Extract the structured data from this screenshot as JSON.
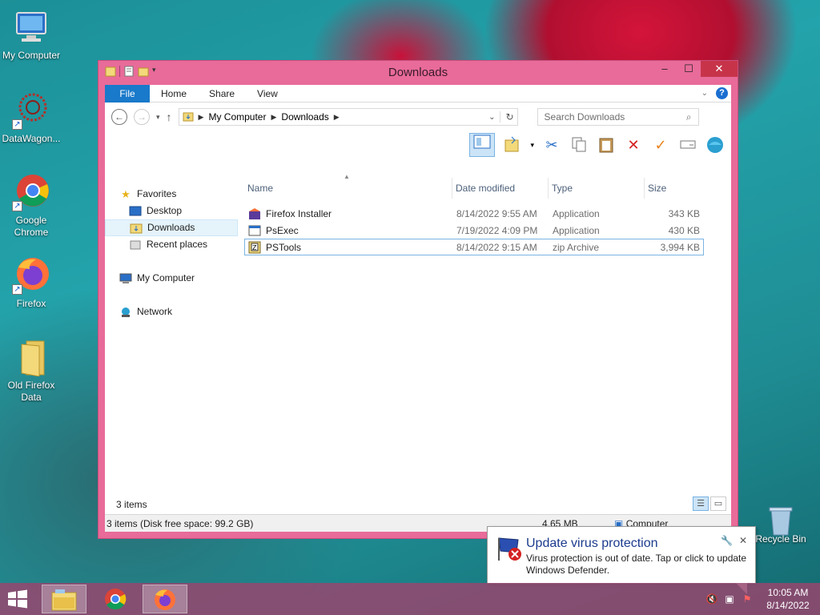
{
  "desktop": {
    "icons": [
      {
        "label": "My Computer"
      },
      {
        "label": "DataWagon..."
      },
      {
        "label": "Google Chrome"
      },
      {
        "label": "Firefox"
      },
      {
        "label": "Old Firefox Data"
      },
      {
        "label": "Recycle Bin"
      }
    ]
  },
  "window": {
    "title": "Downloads",
    "controls": {
      "minimize": "–",
      "maximize": "☐",
      "close": "✕"
    },
    "ribbon": {
      "file": "File",
      "home": "Home",
      "share": "Share",
      "view": "View",
      "help": "?"
    },
    "address": {
      "root": "My Computer",
      "current": "Downloads"
    },
    "search": {
      "placeholder": "Search Downloads"
    },
    "nav": {
      "favorites": "Favorites",
      "desktop": "Desktop",
      "downloads": "Downloads",
      "recent": "Recent places",
      "computer": "My Computer",
      "network": "Network"
    },
    "columns": {
      "name": "Name",
      "date": "Date modified",
      "type": "Type",
      "size": "Size"
    },
    "files": [
      {
        "name": "Firefox Installer",
        "date": "8/14/2022 9:55 AM",
        "type": "Application",
        "size": "343 KB"
      },
      {
        "name": "PsExec",
        "date": "7/19/2022 4:09 PM",
        "type": "Application",
        "size": "430 KB"
      },
      {
        "name": "PSTools",
        "date": "8/14/2022 9:15 AM",
        "type": "zip Archive",
        "size": "3,994 KB"
      }
    ],
    "status": {
      "count": "3 items"
    },
    "infobar": {
      "summary": "3 items (Disk free space: 99.2 GB)",
      "size": "4.65 MB",
      "location": "Computer"
    }
  },
  "balloon": {
    "title": "Update virus protection",
    "message": "Virus protection is out of date. Tap or click to update Windows Defender."
  },
  "taskbar": {
    "time": "10:05 AM",
    "date": "8/14/2022"
  }
}
